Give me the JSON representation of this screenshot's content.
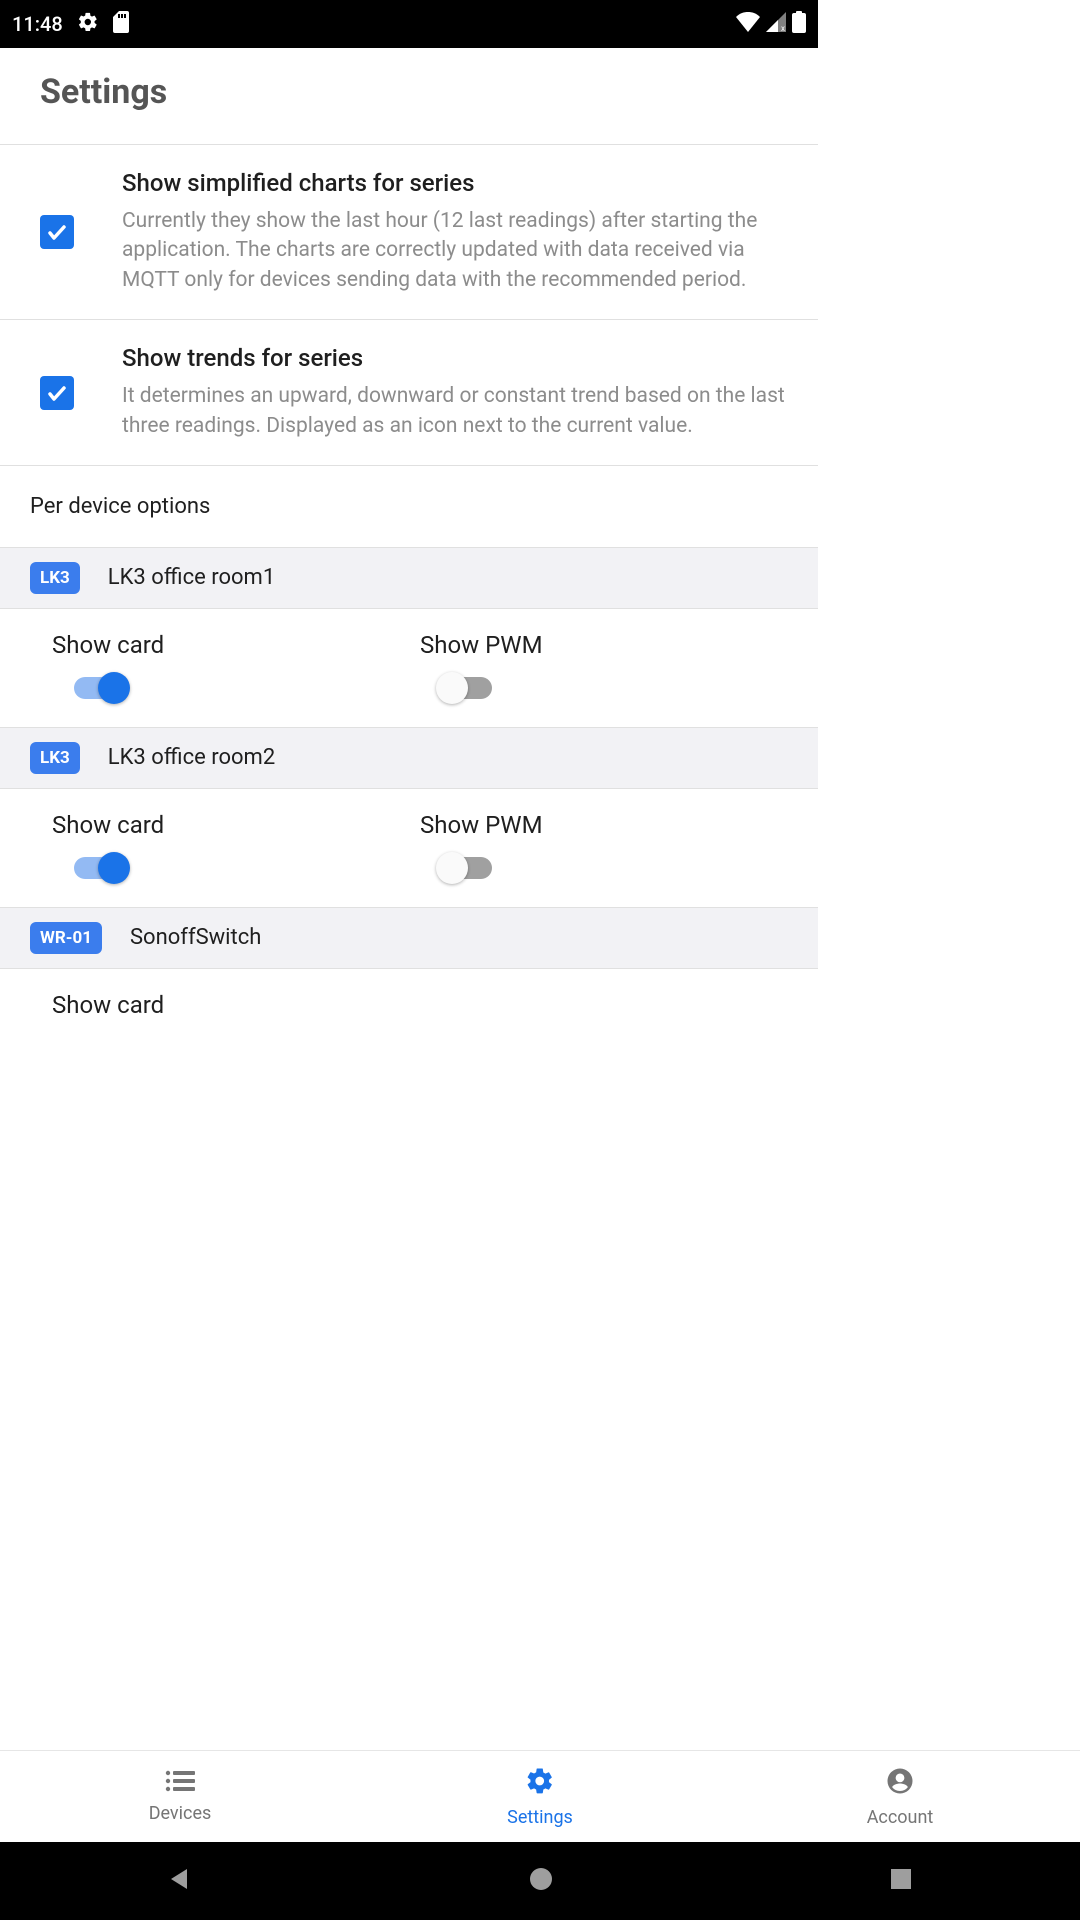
{
  "status": {
    "time": "11:48"
  },
  "header": {
    "title": "Settings"
  },
  "settings": {
    "simplified": {
      "title": "Show simplified charts for series",
      "desc": "Currently they show the last hour (12 last readings) after starting the application. The charts are correctly updated with data received via MQTT only for devices sending data with the recommended period.",
      "checked": true
    },
    "trends": {
      "title": "Show trends for series",
      "desc": "It determines an upward, downward or constant trend based on the last three readings. Displayed as an icon next to the current value.",
      "checked": true
    }
  },
  "per_device_header": "Per device options",
  "devices": [
    {
      "badge": "LK3",
      "name": "LK3 office room1",
      "show_card_label": "Show card",
      "show_card": true,
      "show_pwm_label": "Show PWM",
      "show_pwm": false
    },
    {
      "badge": "LK3",
      "name": "LK3 office room2",
      "show_card_label": "Show card",
      "show_card": true,
      "show_pwm_label": "Show PWM",
      "show_pwm": false
    },
    {
      "badge": "WR-01",
      "name": "SonoffSwitch",
      "show_card_label": "Show card",
      "show_card": true
    }
  ],
  "nav": {
    "devices": "Devices",
    "settings": "Settings",
    "account": "Account"
  }
}
